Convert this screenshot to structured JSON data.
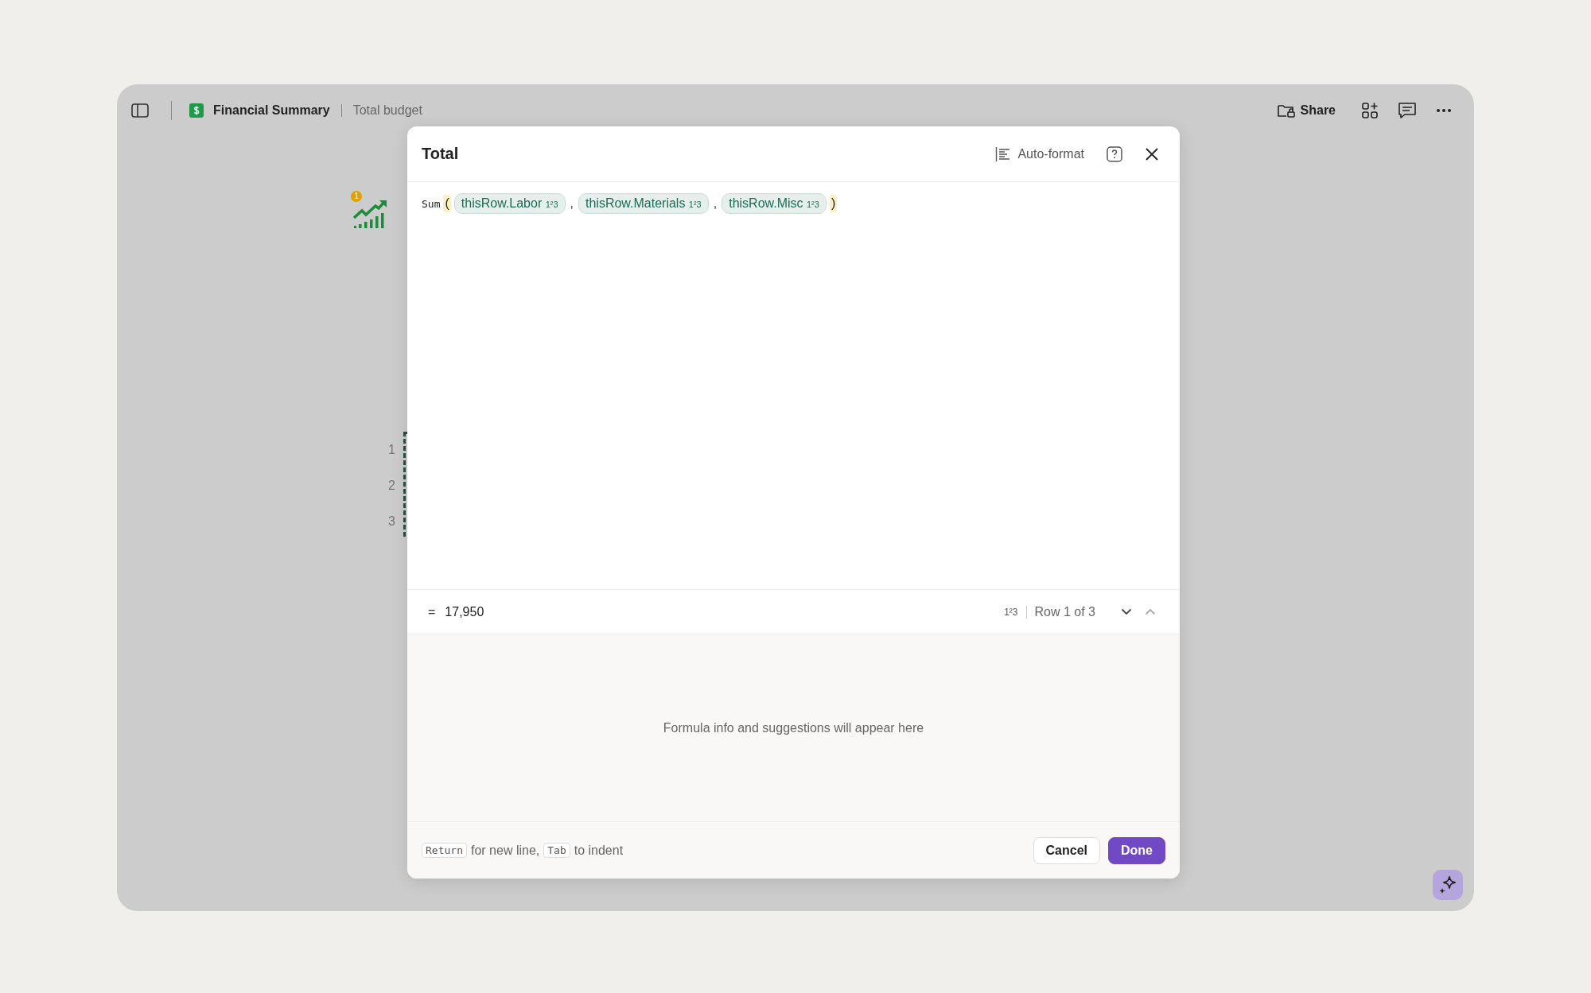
{
  "topbar": {
    "doc_title": "Financial Summary",
    "page_title": "Total budget",
    "share": "Share"
  },
  "document": {
    "badge": "1",
    "row_numbers": [
      "1",
      "2",
      "3"
    ]
  },
  "dialog": {
    "title": "Total",
    "auto_format": "Auto-format",
    "formula": {
      "function": "Sum",
      "open": "(",
      "close": ")",
      "separator": ",",
      "args": [
        {
          "label": "thisRow.Labor",
          "type_mark": "1²3"
        },
        {
          "label": "thisRow.Materials",
          "type_mark": "1²3"
        },
        {
          "label": "thisRow.Misc",
          "type_mark": "1²3"
        }
      ]
    },
    "result": {
      "equals": "=",
      "value": "17,950",
      "type_mark": "1²3",
      "row_label": "Row 1 of 3"
    },
    "info": "Formula info and suggestions will appear here",
    "hint": [
      {
        "kind": "key",
        "text": "Return"
      },
      {
        "kind": "text",
        "text": "for new line,"
      },
      {
        "kind": "key",
        "text": "Tab"
      },
      {
        "kind": "text",
        "text": "to indent"
      }
    ],
    "buttons": [
      {
        "label": "Cancel",
        "primary": false
      },
      {
        "label": "Done",
        "primary": true
      }
    ]
  }
}
